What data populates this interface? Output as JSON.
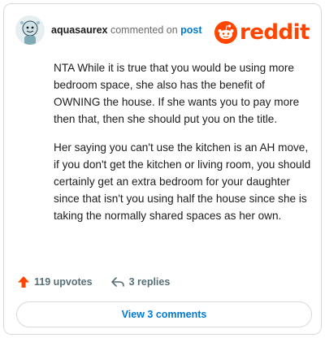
{
  "comment": {
    "username": "aquasaurex",
    "action_text": "commented on",
    "target_link": "post",
    "brand": "reddit",
    "paragraphs": [
      "NTA While it is true that you would be using more bedroom space, she also has the benefit of OWNING the house. If she wants you to pay more then that, then she should put you on the title.",
      "Her saying you can't use the kitchen is an AH move, if you don't get the kitchen or living room, you should certainly get an extra bedroom for your daughter since that isn't you using half the house since she is taking the normally shared spaces as her own."
    ]
  },
  "actions": {
    "upvotes": "119 upvotes",
    "replies": "3 replies"
  },
  "view_button": "View 3 comments",
  "colors": {
    "brand": "#ff4500",
    "link": "#0079d3",
    "muted": "#576f76"
  },
  "icons": [
    "avatar",
    "reddit-alien-icon",
    "upvote-arrow-icon",
    "reply-icon"
  ]
}
